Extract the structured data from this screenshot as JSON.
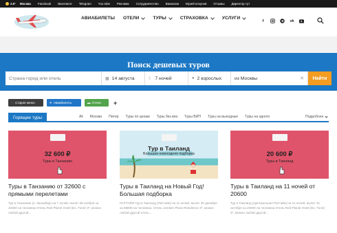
{
  "topbar": {
    "temperature": "2.5°",
    "city": "Москва",
    "links": [
      "Facebook",
      "Вконтакте",
      "Telegram",
      "You tube",
      "Реклама",
      "Сотрудничество",
      "Вакансии",
      "Музей клоунов",
      "Отзывы",
      "Директор тут"
    ]
  },
  "nav": {
    "items": [
      "АВИАБИЛЕТЫ",
      "ОТЕЛИ",
      "ТУРЫ",
      "СТРАХОВКА",
      "УСЛУГИ"
    ],
    "socials": [
      "facebook-icon",
      "instagram-icon",
      "telegram-icon",
      "vk-icon",
      "youtube-icon"
    ]
  },
  "hero": {
    "title": "Поиск дешевых туров",
    "origin_placeholder": "Страна город или отель",
    "date": "14 августа",
    "nights": "7 ночей",
    "adults": "2 взрослых",
    "from": "из Москвы",
    "find_button": "Найти"
  },
  "filters": {
    "buttons": [
      "Старое меню",
      "Авиабилеты",
      "Отели"
    ],
    "plus": "+"
  },
  "hot": {
    "label": "Горящие туры",
    "tabs": [
      "All",
      "Москва",
      "Питер",
      "Туры по ценам",
      "Туры без виз",
      "Туры ВИП",
      "Туры на выходные",
      "Туры на одного"
    ],
    "more": "Подробнее"
  },
  "cards": [
    {
      "price": "32 600 ₽",
      "price_caption": "Туры в Танзанию",
      "title": "Туры в Танзанию от 32600 с прямыми перелетами",
      "text": "Тур в Танзанию (о. Занзибар) на 7 ночей, вылет 09 ноября за 32600 на человека Отель Red Planet Hotel (Ex. Tune) 3*, можно любой другой..."
    },
    {
      "banner_title": "Тур в Таиланд",
      "banner_sub": "Большая новогодняя подборка",
      "title": "Туры в Таиланд на Новый Год! Большая подборка",
      "text": "ПАТТАЙЯ Тур в Таиланд (Паттайя) на 11 ночей, вылет 30 декабря за 68800 на человека. Отель Jomtien Plaza Residence 3*, можно любой другой отель..."
    },
    {
      "price": "20 600 ₽",
      "price_caption": "Туры в Таиланд",
      "title": "Туры в Таиланд на 11 ночей от 20600",
      "text": "Тур в Таиланд (Центральная Паттайя) на 11 ночей, вылет 31 октября за 20600 на человека Отель Red Planet Hotel (Ex. Tune) 3*, можно любой другой..."
    }
  ],
  "colors": {
    "accent_blue": "#1c78c4",
    "find_orange": "#f39c21",
    "card_pink": "#e0546b"
  }
}
